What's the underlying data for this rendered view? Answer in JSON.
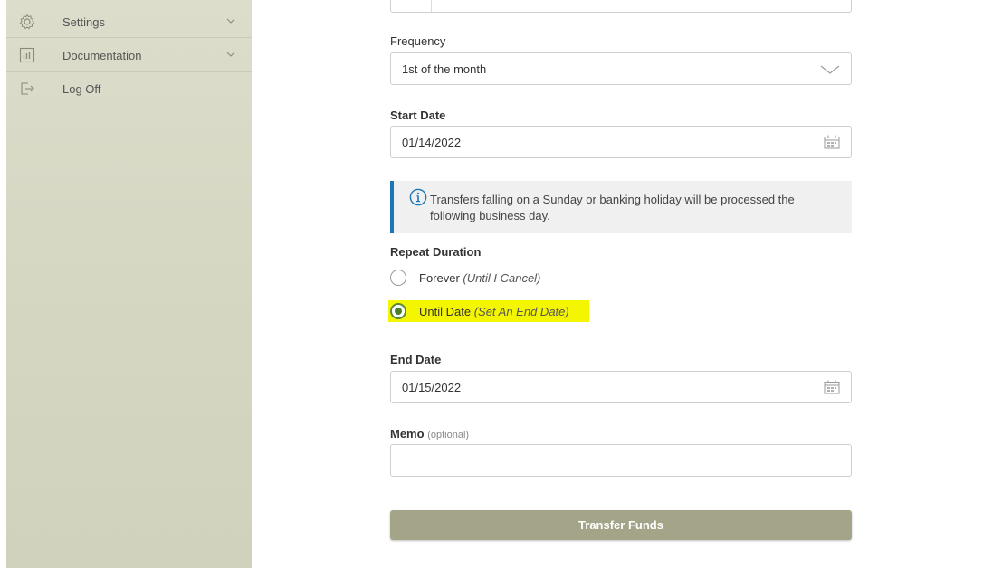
{
  "sidebar": {
    "items": [
      {
        "label": "Settings",
        "icon": "gear-icon",
        "has_chevron": true
      },
      {
        "label": "Documentation",
        "icon": "bar-chart-icon",
        "has_chevron": true
      },
      {
        "label": "Log Off",
        "icon": "log-off-icon",
        "has_chevron": false
      }
    ]
  },
  "form": {
    "frequency": {
      "label": "Frequency",
      "value": "1st of the month"
    },
    "start_date": {
      "label": "Start Date",
      "value": "01/14/2022"
    },
    "notice": "Transfers falling on a Sunday or banking holiday will be processed the following business day.",
    "repeat_duration": {
      "label": "Repeat Duration",
      "options": [
        {
          "label": "Forever",
          "hint": "(Until I Cancel)",
          "selected": false
        },
        {
          "label": "Until Date",
          "hint": "(Set An End Date)",
          "selected": true
        }
      ]
    },
    "end_date": {
      "label": "End Date",
      "value": "01/15/2022"
    },
    "memo": {
      "label": "Memo",
      "optional": "(optional)",
      "value": ""
    },
    "submit_label": "Transfer Funds"
  },
  "colors": {
    "sidebar_bg": "#d6d8c4",
    "accent_blue": "#1b76b8",
    "button_bg": "#a3a488",
    "radio_selected": "#4d7f2e",
    "highlight": "#f4f600"
  }
}
